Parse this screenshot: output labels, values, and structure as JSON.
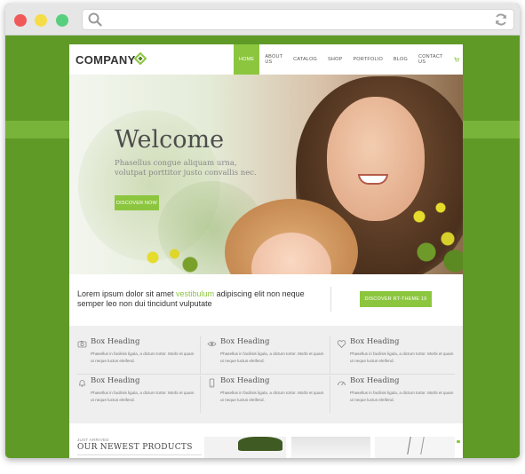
{
  "browser": {
    "controls": [
      "close",
      "minimize",
      "maximize"
    ],
    "icons": {
      "search": "search-icon",
      "reload": "reload-icon"
    }
  },
  "site": {
    "logo": "COMPANY",
    "nav": [
      "HOME",
      "ABOUT US",
      "CATALOG",
      "SHOP",
      "PORTFOLIO",
      "BLOG",
      "CONTACT US"
    ],
    "nav_active": "HOME",
    "icons": {
      "cart": "cart-icon",
      "search": "search-icon"
    },
    "hero": {
      "title": "Welcome",
      "subtitle": "Phasellus congue aliquam urna, volutpat porttitor justo convallis nec.",
      "cta": "DISCOVER NOW"
    },
    "promo": {
      "text_before": "Lorem ipsum dolor sit amet ",
      "highlight": "vestibulum",
      "text_after": " adipiscing elit non neque semper leo non dui tincidunt vulputate",
      "button": "DISCOVER RT-THEME 19"
    },
    "features": [
      {
        "icon": "camera-icon",
        "heading": "Box Heading",
        "text": "Phasellus in facilisis ligula, a dictum tortor. Morbi et quam ut neque luctus eleifend."
      },
      {
        "icon": "eye-icon",
        "heading": "Box Heading",
        "text": "Phasellus in facilisis ligula, a dictum tortor. Morbi et quam ut neque luctus eleifend."
      },
      {
        "icon": "heart-icon",
        "heading": "Box Heading",
        "text": "Phasellus in facilisis ligula, a dictum tortor. Morbi et quam ut neque luctus eleifend."
      },
      {
        "icon": "bell-icon",
        "heading": "Box Heading",
        "text": "Phasellus in facilisis ligula, a dictum tortor. Morbi et quam ut neque luctus eleifend."
      },
      {
        "icon": "phone-icon",
        "heading": "Box Heading",
        "text": "Phasellus in facilisis ligula, a dictum tortor. Morbi et quam ut neque luctus eleifend."
      },
      {
        "icon": "gauge-icon",
        "heading": "Box Heading",
        "text": "Phasellus in facilisis ligula, a dictum tortor. Morbi et quam ut neque luctus eleifend."
      }
    ],
    "products": {
      "kicker": "JUST ARRIVED",
      "title": "OUR NEWEST PRODUCTS"
    }
  },
  "colors": {
    "accent": "#8cc63f",
    "background_green": "#5f9a27",
    "band_green": "#78b43a"
  }
}
